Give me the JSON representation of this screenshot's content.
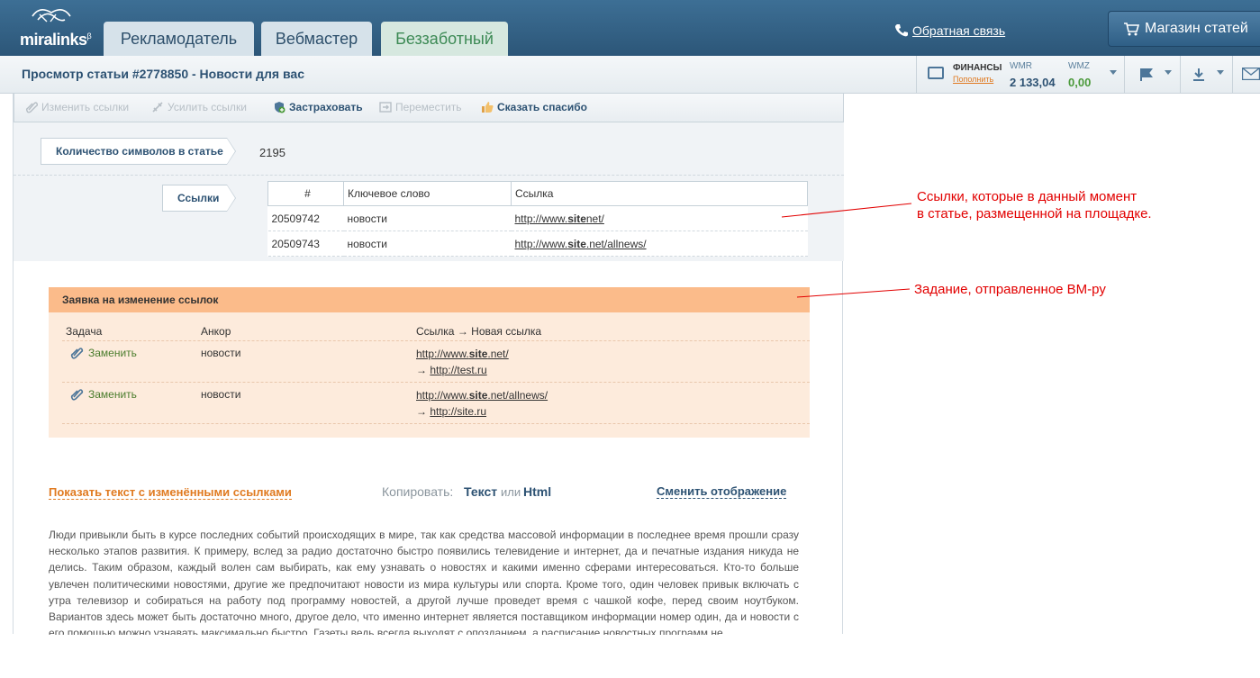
{
  "header": {
    "logo_text": "miralinks",
    "logo_sup": "β",
    "tabs": [
      {
        "label": "Рекламодатель"
      },
      {
        "label": "Вебмастер"
      },
      {
        "label": "Беззаботный"
      }
    ],
    "feedback_label": "Обратная связь",
    "shop_label": "Магазин статей"
  },
  "subheader": {
    "title": "Просмотр статьи #2778850 - Новости для вас",
    "finance_label": "ФИНАНСЫ",
    "topup_label": "Пополнить",
    "wmr_label": "WMR",
    "wmr_value": "2 133,04",
    "wmz_label": "WMZ",
    "wmz_value": "0,00"
  },
  "toolbar": {
    "change_links": "Изменить ссылки",
    "boost_links": "Усилить ссылки",
    "insure": "Застраховать",
    "move": "Переместить",
    "thanks": "Сказать спасибо"
  },
  "info": {
    "char_count_label": "Количество символов в статье",
    "char_count_value": "2195",
    "links_label": "Ссылки",
    "table_headers": [
      "#",
      "Ключевое слово",
      "Ссылка"
    ],
    "rows": [
      {
        "id": "20509742",
        "keyword": "новости",
        "url_pre": "http://www.",
        "url_bold": "site",
        "url_post": "net/"
      },
      {
        "id": "20509743",
        "keyword": "новости",
        "url_pre": "http://www.",
        "url_bold": "site",
        "url_post": ".net/allnews/"
      }
    ]
  },
  "request": {
    "title": "Заявка на изменение ссылок",
    "col_task": "Задача",
    "col_anchor": "Анкор",
    "col_link": "Ссылка → Новая ссылка",
    "items": [
      {
        "task": "Заменить",
        "anchor": "новости",
        "old_pre": "http://www.",
        "old_bold": "site",
        "old_post": ".net/",
        "arrow": "→",
        "new_url": "http://test.ru"
      },
      {
        "task": "Заменить",
        "anchor": "новости",
        "old_pre": "http://www.",
        "old_bold": "site",
        "old_post": ".net/allnews/",
        "arrow": "→",
        "new_url": "http://site.ru"
      }
    ]
  },
  "bottom": {
    "show_text": "Показать текст с изменёнными ссылками",
    "copy_label": "Копировать:",
    "copy_text": "Текст",
    "copy_or": "или",
    "copy_html": "Html",
    "switch_view": "Сменить отображение"
  },
  "article_text": "Люди привыкли быть в курсе последних событий происходящих в мире, так как средства массовой информации в последнее время прошли сразу несколько этапов развития. К примеру, вслед за радио достаточно быстро появились телевидение и интернет, да и печатные издания никуда не делись. Таким образом, каждый волен сам выбирать, как ему узнавать о новостях и какими именно сферами интересоваться. Кто-то больше увлечен политическими новостями, другие же предпочитают новости из мира культуры или спорта. Кроме того, один человек привык включать с утра телевизор и собираться на работу под программу новостей, а другой лучше проведет время с чашкой кофе, перед своим ноутбуком. Вариантов здесь может быть достаточно много, другое дело, что именно интернет является поставщиком информации номер один, да и новости с его помощью можно узнавать максимально быстро. Газеты ведь всегда выходят с опозданием, а расписание новостных программ не",
  "annotations": {
    "note1_line1": "Ссылки, которые в данный момент",
    "note1_line2": "в статье, размещенной на площадке.",
    "note2": "Задание, отправленное ВМ-ру"
  },
  "colors": {
    "header_bg": "#2c5678",
    "accent_orange": "#e07a20",
    "request_header": "#fbbb8a",
    "request_bg": "#fdebdc",
    "annotation_red": "#e20000"
  }
}
